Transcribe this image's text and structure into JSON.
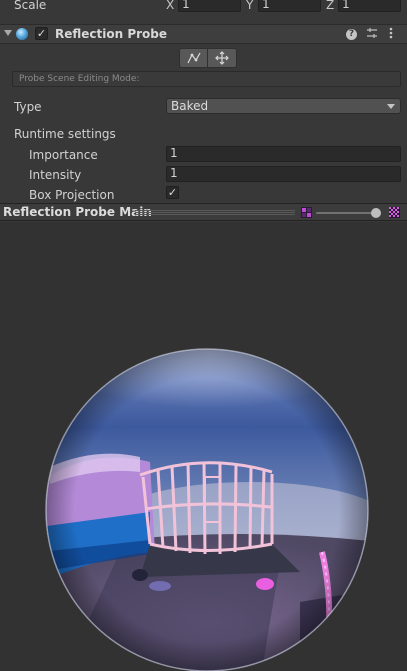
{
  "transform": {
    "scale_label": "Scale",
    "x_label": "X",
    "x_value": "1",
    "y_label": "Y",
    "y_value": "1",
    "z_label": "Z",
    "z_value": "1"
  },
  "component": {
    "title": "Reflection Probe",
    "enabled": true,
    "help_icon": "?",
    "settings_icon": "sliders-icon",
    "more_icon": "kebab-icon"
  },
  "editing": {
    "mode_placeholder": "Probe Scene Editing Mode:"
  },
  "fields": {
    "type_label": "Type",
    "type_value": "Baked",
    "runtime_label": "Runtime settings",
    "importance_label": "Importance",
    "importance_value": "1",
    "intensity_label": "Intensity",
    "intensity_value": "1",
    "box_projection_label": "Box Projection",
    "box_projection_checked": true
  },
  "preview": {
    "title": "Reflection Probe Main",
    "mip_level": 1.0
  },
  "colors": {
    "panel_bg": "#383838",
    "field_bg": "#2a2a2a",
    "header_bg": "#3e3e3e",
    "preview_bg": "#323232",
    "accent_pink": "#e060d0"
  }
}
